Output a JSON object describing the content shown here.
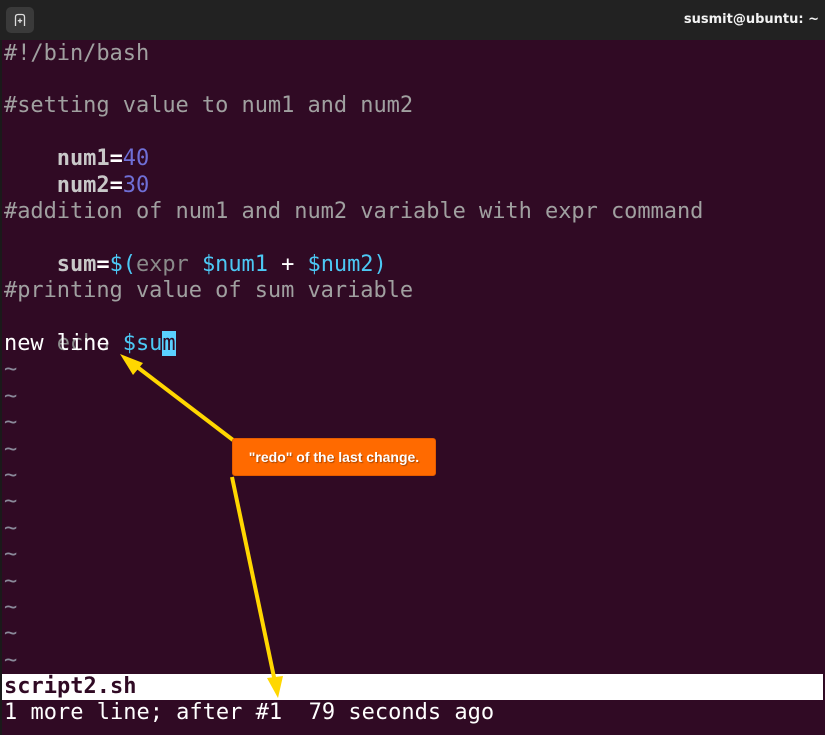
{
  "titlebar": {
    "title": "susmit@ubuntu: ~",
    "new_tab_icon": "new-tab-icon"
  },
  "editor": {
    "lines": [
      {
        "kind": "comment",
        "text": "#!/bin/bash"
      },
      {
        "kind": "blank",
        "text": ""
      },
      {
        "kind": "comment",
        "text": "#setting value to num1 and num2"
      },
      {
        "kind": "assign",
        "var": "num1",
        "eq": "=",
        "value": "40"
      },
      {
        "kind": "assign",
        "var": "num2",
        "eq": "=",
        "value": "30"
      },
      {
        "kind": "blank",
        "text": ""
      },
      {
        "kind": "comment",
        "text": "#addition of num1 and num2 variable with expr command"
      },
      {
        "kind": "expr",
        "var": "sum",
        "eq": "=",
        "open": "$(",
        "cmd": "expr ",
        "arg1": "$num1",
        "op": " + ",
        "arg2": "$num2",
        "close": ")"
      },
      {
        "kind": "blank",
        "text": ""
      },
      {
        "kind": "comment",
        "text": "#printing value of sum variable"
      },
      {
        "kind": "echo",
        "cmd": "echo ",
        "var_before_cursor": "$su",
        "cursor_char": "m"
      },
      {
        "kind": "plain",
        "text": "new line"
      }
    ],
    "tilde": "~",
    "tilde_count": 12
  },
  "statusbar": {
    "filename": "script2.sh",
    "message": "1 more line; after #1  79 seconds ago"
  },
  "annotation": {
    "callout_text": "\"redo\" of the last change.",
    "callout_color": "#ff6a00",
    "arrow_color": "#ffd700"
  }
}
